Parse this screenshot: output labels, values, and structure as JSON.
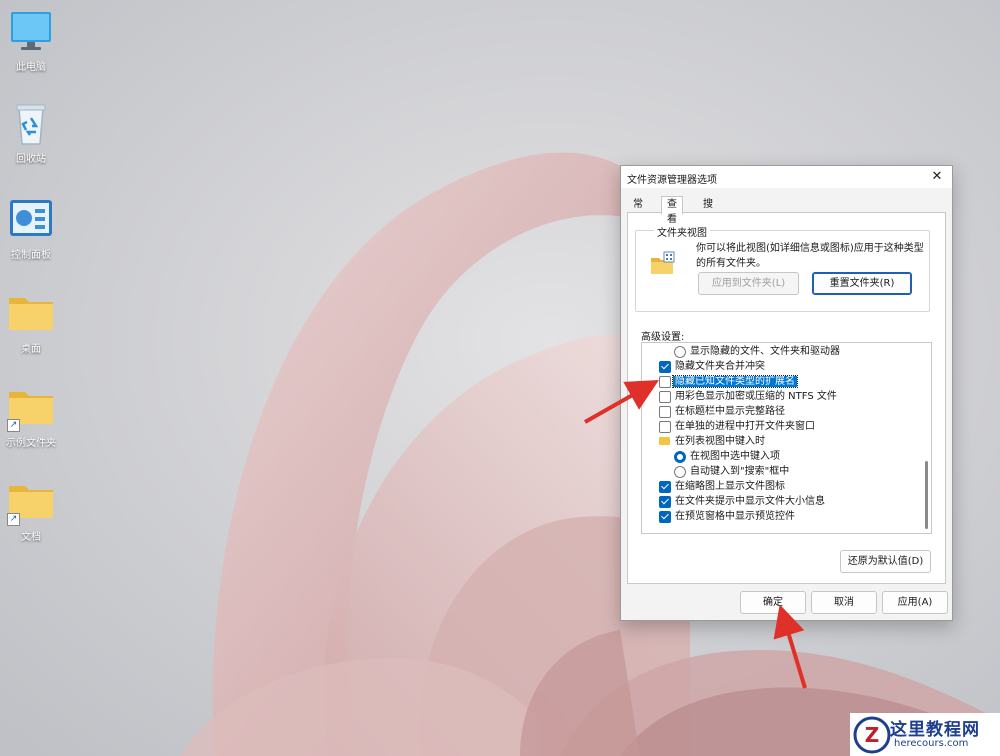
{
  "desktop": {
    "icons": [
      {
        "label": "此电脑",
        "icon": "monitor-icon"
      },
      {
        "label": "回收站",
        "icon": "recycle-bin-icon"
      },
      {
        "label": "控制面板",
        "icon": "control-panel-icon"
      },
      {
        "label": "桌面",
        "icon": "folder-icon"
      },
      {
        "label": "示例文件夹",
        "icon": "folder-shortcut-icon"
      },
      {
        "label": "文档",
        "icon": "folder-shortcut-icon"
      }
    ]
  },
  "dialog": {
    "title": "文件资源管理器选项",
    "close_glyph": "✕",
    "tabs": [
      {
        "label": "常规",
        "active": false
      },
      {
        "label": "查看",
        "active": true
      },
      {
        "label": "搜索",
        "active": false
      }
    ],
    "folder_views": {
      "title": "文件夹视图",
      "description": "你可以将此视图(如详细信息或图标)应用于这种类型的所有文件夹。",
      "apply_button": "应用到文件夹(L)",
      "apply_enabled": false,
      "reset_button": "重置文件夹(R)"
    },
    "advanced": {
      "label": "高级设置:",
      "items": [
        {
          "type": "radio",
          "checked": false,
          "level": 2,
          "text": "显示隐藏的文件、文件夹和驱动器"
        },
        {
          "type": "checkbox",
          "checked": true,
          "level": 1,
          "text": "隐藏文件夹合并冲突"
        },
        {
          "type": "checkbox",
          "checked": false,
          "level": 1,
          "text": "隐藏已知文件类型的扩展名",
          "highlighted": true
        },
        {
          "type": "checkbox",
          "checked": false,
          "level": 1,
          "text": "用彩色显示加密或压缩的 NTFS 文件"
        },
        {
          "type": "checkbox",
          "checked": false,
          "level": 1,
          "text": "在标题栏中显示完整路径"
        },
        {
          "type": "checkbox",
          "checked": false,
          "level": 1,
          "text": "在单独的进程中打开文件夹窗口"
        },
        {
          "type": "folder",
          "level": 1,
          "text": "在列表视图中键入时"
        },
        {
          "type": "radio",
          "checked": true,
          "level": 2,
          "text": "在视图中选中键入项"
        },
        {
          "type": "radio",
          "checked": false,
          "level": 2,
          "text": "自动键入到\"搜索\"框中"
        },
        {
          "type": "checkbox",
          "checked": true,
          "level": 1,
          "text": "在缩略图上显示文件图标"
        },
        {
          "type": "checkbox",
          "checked": true,
          "level": 1,
          "text": "在文件夹提示中显示文件大小信息"
        },
        {
          "type": "checkbox",
          "checked": true,
          "level": 1,
          "text": "在预览窗格中显示预览控件"
        }
      ],
      "restore_button": "还原为默认值(D)"
    },
    "footer": {
      "ok": "确定",
      "cancel": "取消",
      "apply": "应用(A)"
    }
  },
  "watermark": {
    "logo_letter": "Z",
    "title": "这里教程网",
    "url": "herecours.com"
  },
  "colors": {
    "accent": "#0067c0",
    "selection": "#0078d4",
    "annotation_arrow": "#e0302a"
  }
}
